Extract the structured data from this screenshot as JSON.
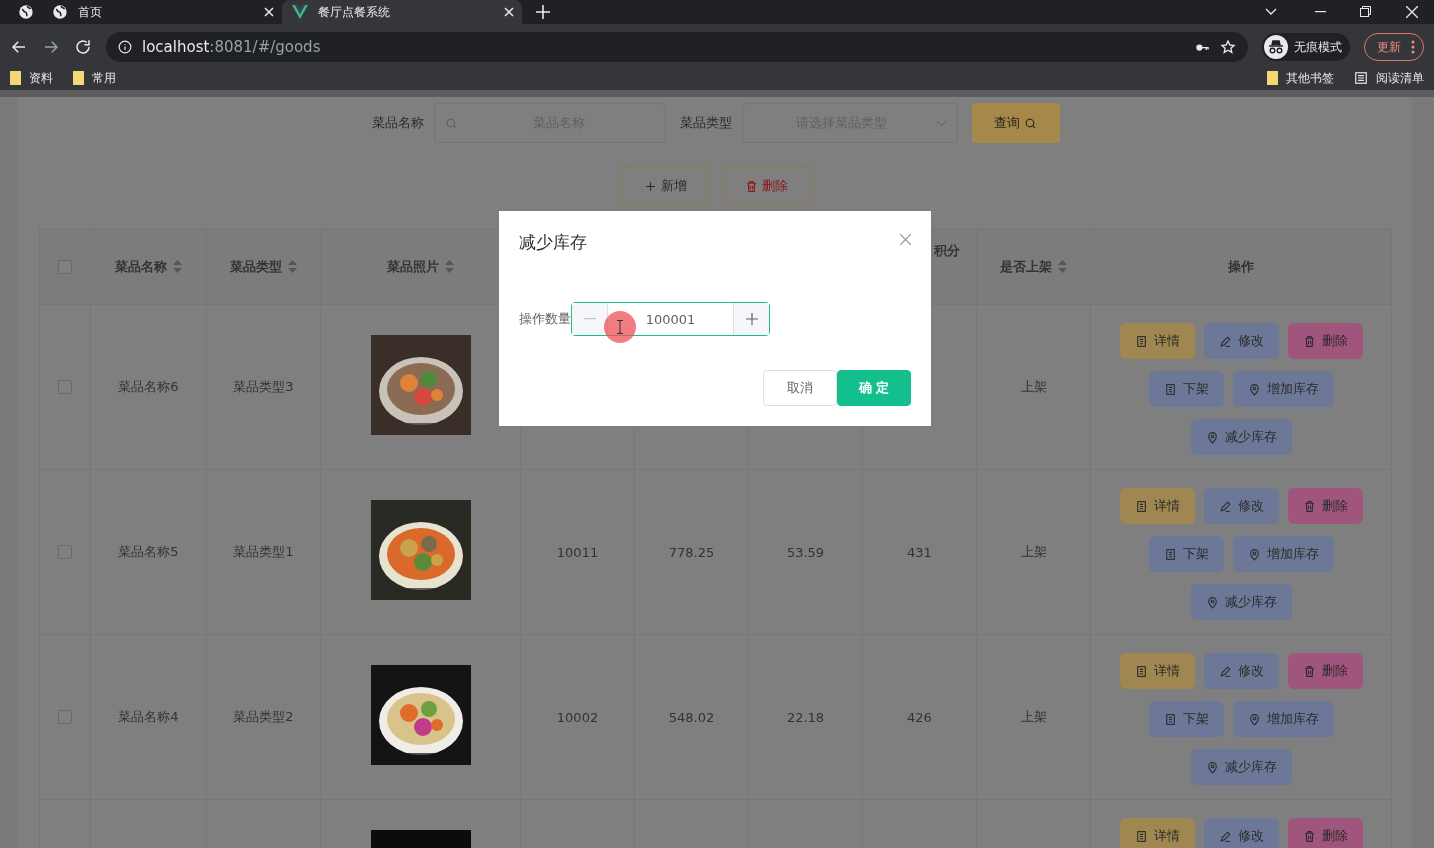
{
  "browser": {
    "tabs": [
      {
        "selected": false
      },
      {
        "title": "首页",
        "selected": false
      },
      {
        "title": "餐厅点餐系统",
        "selected": true
      }
    ],
    "address": {
      "host": "localhost",
      "path": ":8081/#/goods"
    },
    "profile": "无痕模式",
    "update_button": "更新",
    "bookmarks": [
      {
        "label": "资料",
        "kind": "folder"
      },
      {
        "label": "常用",
        "kind": "folder"
      }
    ],
    "bookmarks_right": [
      {
        "label": "其他书签",
        "kind": "folder"
      },
      {
        "label": "阅读清单",
        "kind": "list"
      }
    ]
  },
  "search": {
    "fields": [
      {
        "label": "菜品名称",
        "placeholder": "菜品名称",
        "kind": "text"
      },
      {
        "label": "菜品类型",
        "placeholder": "请选择菜品类型",
        "kind": "select"
      }
    ],
    "button": "查询"
  },
  "toolbar": [
    {
      "label": "新增",
      "kind": "add"
    },
    {
      "label": "删除",
      "kind": "delete"
    }
  ],
  "table": {
    "header_checked": false,
    "columns": [
      {
        "label": "菜品名称",
        "sortable": true
      },
      {
        "label": "菜品类型",
        "sortable": true
      },
      {
        "label": "菜品照片",
        "sortable": true
      },
      {},
      {},
      {},
      {
        "label": "积分"
      },
      {
        "label": "是否上架",
        "sortable": true
      },
      {
        "label": "操作",
        "sortable": false
      }
    ],
    "rows": [
      {
        "checked": false,
        "name": "菜品名称6",
        "type": "菜品类型3",
        "photo": {
          "kind": "picture"
        },
        "status": "上架",
        "actions": [
          {
            "label": "详情",
            "kind": "detail",
            "color": "#a08650"
          },
          {
            "label": "修改",
            "kind": "edit",
            "color": "#6d7797"
          },
          {
            "label": "删除",
            "kind": "delete",
            "color": "#a0567c"
          },
          {
            "label": "下架",
            "kind": "detail",
            "color": "#6d7797"
          },
          {
            "label": "增加库存",
            "kind": "pin",
            "color": "#6d7797"
          },
          {
            "label": "减少库存",
            "kind": "pin",
            "color": "#6d7797"
          }
        ]
      },
      {
        "checked": false,
        "name": "菜品名称5",
        "type": "菜品类型1",
        "photo": {
          "kind": "picture"
        },
        "values": [
          "10011",
          "778.25",
          "53.59",
          "431"
        ],
        "status": "上架",
        "actions": [
          {
            "label": "详情",
            "kind": "detail",
            "color": "#a08650"
          },
          {
            "label": "修改",
            "kind": "edit",
            "color": "#6d7797"
          },
          {
            "label": "删除",
            "kind": "delete",
            "color": "#a0567c"
          },
          {
            "label": "下架",
            "kind": "detail",
            "color": "#6d7797"
          },
          {
            "label": "增加库存",
            "kind": "pin",
            "color": "#6d7797"
          },
          {
            "label": "减少库存",
            "kind": "pin",
            "color": "#6d7797"
          }
        ]
      },
      {
        "checked": false,
        "name": "菜品名称4",
        "type": "菜品类型2",
        "photo": {
          "kind": "picture"
        },
        "values": [
          "10002",
          "548.02",
          "22.18",
          "426"
        ],
        "status": "上架",
        "actions": [
          {
            "label": "详情",
            "kind": "detail",
            "color": "#a08650"
          },
          {
            "label": "修改",
            "kind": "edit",
            "color": "#6d7797"
          },
          {
            "label": "删除",
            "kind": "delete",
            "color": "#a0567c"
          },
          {
            "label": "下架",
            "kind": "detail",
            "color": "#6d7797"
          },
          {
            "label": "增加库存",
            "kind": "pin",
            "color": "#6d7797"
          },
          {
            "label": "减少库存",
            "kind": "pin",
            "color": "#6d7797"
          }
        ]
      },
      {
        "photo": {
          "kind": "picture"
        },
        "actions": [
          {
            "label": "详情",
            "kind": "detail",
            "color": "#a08650"
          },
          {
            "label": "修改",
            "kind": "edit",
            "color": "#6d7797"
          },
          {
            "label": "删除",
            "kind": "delete",
            "color": "#a0567c"
          }
        ]
      }
    ]
  },
  "dialog": {
    "title": "减少库存",
    "field": {
      "label": "操作数量",
      "value": "100001"
    },
    "buttons": [
      {
        "label": "取消",
        "kind": "secondary"
      },
      {
        "label": "确 定",
        "kind": "primary"
      }
    ]
  }
}
